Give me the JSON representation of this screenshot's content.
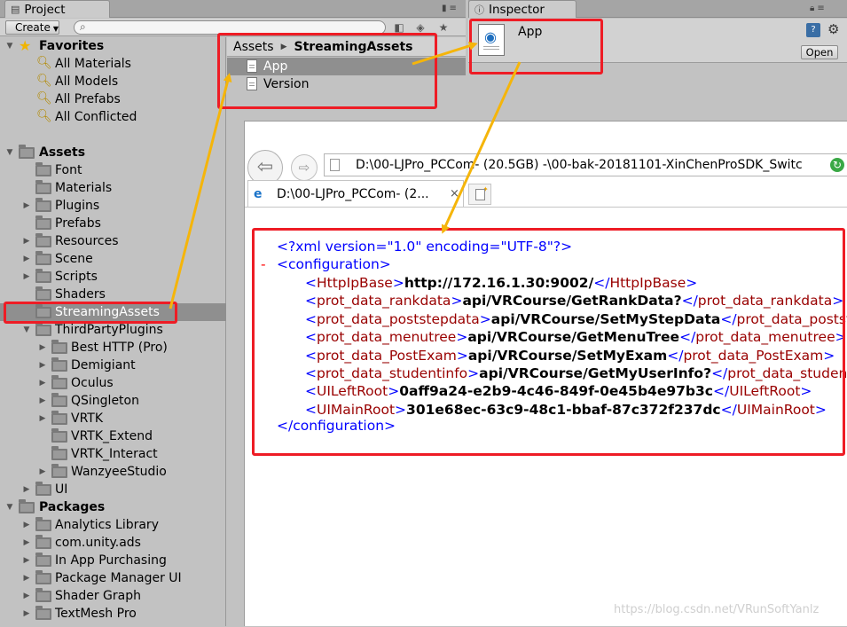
{
  "project": {
    "tab_label": "Project",
    "create_label": "Create",
    "search_value": "",
    "favorites": {
      "label": "Favorites",
      "items": [
        "All Materials",
        "All Models",
        "All Prefabs",
        "All Conflicted"
      ]
    },
    "assets": {
      "label": "Assets",
      "items": [
        "Font",
        "Materials",
        "Plugins",
        "Prefabs",
        "Resources",
        "Scene",
        "Scripts",
        "Shaders",
        "StreamingAssets",
        "ThirdPartyPlugins",
        "UI"
      ],
      "thirdparty_children": [
        "Best HTTP (Pro)",
        "Demigiant",
        "Oculus",
        "QSingleton",
        "VRTK",
        "VRTK_Extend",
        "VRTK_Interact",
        "WanzyeeStudio"
      ]
    },
    "packages": {
      "label": "Packages",
      "items": [
        "Analytics Library",
        "com.unity.ads",
        "In App Purchasing",
        "Package Manager UI",
        "Shader Graph",
        "TextMesh Pro"
      ]
    }
  },
  "asset_list": {
    "breadcrumb_root": "Assets",
    "breadcrumb_current": "StreamingAssets",
    "items": [
      "App",
      "Version"
    ]
  },
  "inspector": {
    "tab_label": "Inspector",
    "title": "App",
    "open_label": "Open"
  },
  "browser": {
    "address": "D:\\00-LJPro_PCCom-  (20.5GB)  -\\00-bak-20181101-XinChenProSDK_Switc",
    "tab_title": "D:\\00-LJPro_PCCom-  (2...",
    "tab_close": "×",
    "xml": {
      "decl": "<?xml version=\"1.0\" encoding=\"UTF-8\"?>",
      "collapse_marker": "-",
      "root_open": "<configuration>",
      "root_close": "</configuration>",
      "entries": [
        {
          "tag": "HttpIpBase",
          "value": "http://172.16.1.30:9002/"
        },
        {
          "tag": "prot_data_rankdata",
          "value": "api/VRCourse/GetRankData?"
        },
        {
          "tag": "prot_data_poststepdata",
          "value": "api/VRCourse/SetMyStepData"
        },
        {
          "tag": "prot_data_menutree",
          "value": "api/VRCourse/GetMenuTree"
        },
        {
          "tag": "prot_data_PostExam",
          "value": "api/VRCourse/SetMyExam"
        },
        {
          "tag": "prot_data_studentinfo",
          "value": "api/VRCourse/GetMyUserInfo?"
        },
        {
          "tag": "UILeftRoot",
          "value": "0aff9a24-e2b9-4c46-849f-0e45b4e97b3c"
        },
        {
          "tag": "UIMainRoot",
          "value": "301e68ec-63c9-48c1-bbaf-87c372f237dc"
        }
      ]
    }
  },
  "watermark": "https://blog.csdn.net/VRunSoftYanlz",
  "colors": {
    "annotation_red": "#ee1c25",
    "annotation_arrow": "#f5b50a",
    "xml_markup_blue": "#0000ff",
    "xml_tag_red": "#990000"
  }
}
